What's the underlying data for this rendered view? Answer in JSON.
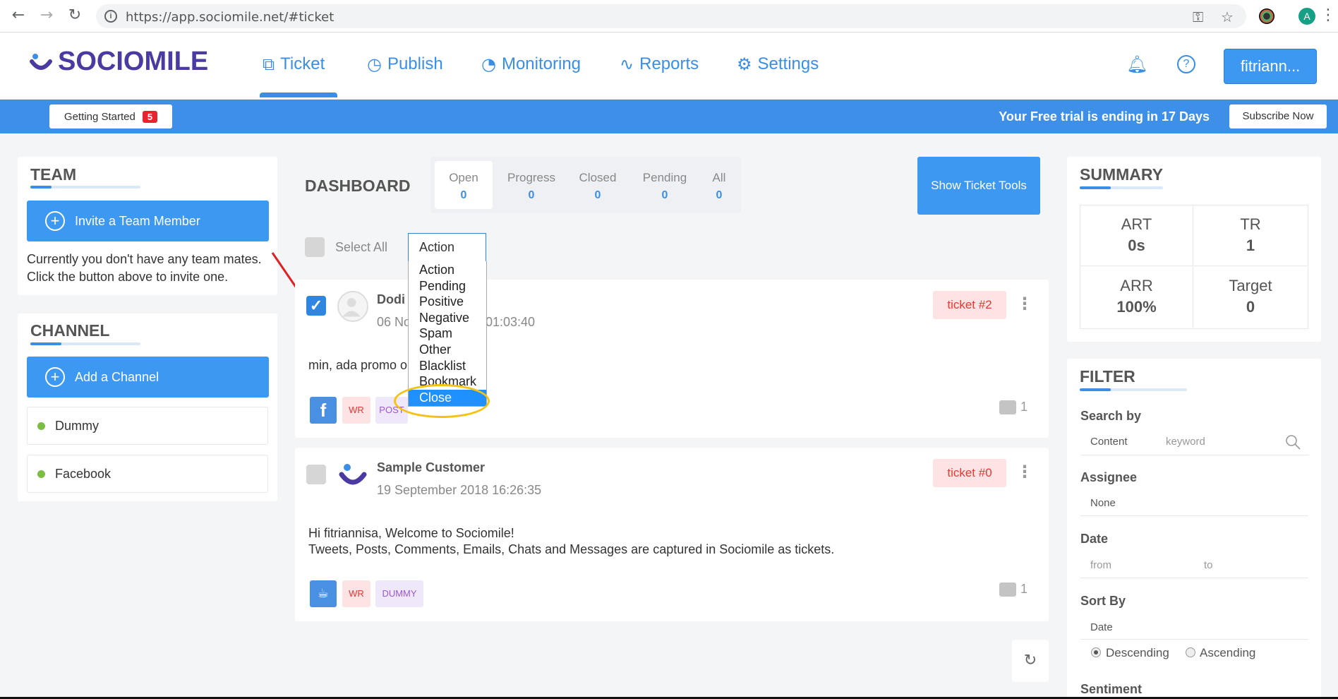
{
  "browser": {
    "url": "https://app.sociomile.net/#ticket",
    "back_icon": "arrow-left-icon",
    "forward_icon": "arrow-right-icon",
    "reload_icon": "reload-icon",
    "profile_initial": "A"
  },
  "header": {
    "logo_text": "SOCIOMILE",
    "nav": [
      {
        "label": "Ticket",
        "icon": "ticket-icon"
      },
      {
        "label": "Publish",
        "icon": "timer-icon"
      },
      {
        "label": "Monitoring",
        "icon": "gauge-icon"
      },
      {
        "label": "Reports",
        "icon": "pulse-icon"
      },
      {
        "label": "Settings",
        "icon": "gear-icon"
      }
    ],
    "user_label": "fitriann..."
  },
  "banner": {
    "getting_started_label": "Getting Started",
    "getting_started_count": "5",
    "trial_text": "Your Free trial is ending in 17 Days",
    "subscribe_label": "Subscribe Now"
  },
  "team": {
    "title": "TEAM",
    "invite_label": "Invite a Team Member",
    "empty_line1": "Currently you don't have any team mates.",
    "empty_line2": "Click the button above to invite one."
  },
  "channel": {
    "title": "CHANNEL",
    "add_label": "Add a Channel",
    "items": [
      "Dummy",
      "Facebook"
    ],
    "status_color": "#7cbd42"
  },
  "dashboard": {
    "title": "DASHBOARD",
    "tabs": [
      {
        "label": "Open",
        "count": "0"
      },
      {
        "label": "Progress",
        "count": "0"
      },
      {
        "label": "Closed",
        "count": "0"
      },
      {
        "label": "Pending",
        "count": "0"
      },
      {
        "label": "All",
        "count": "0"
      }
    ],
    "show_tools_label": "Show Ticket Tools",
    "select_all_label": "Select All",
    "action_selected": "Action",
    "action_options": [
      "Action",
      "Pending",
      "Positive",
      "Negative",
      "Spam",
      "Other",
      "Blacklist",
      "Bookmark",
      "Close"
    ],
    "highlighted_option": "Close"
  },
  "tickets": [
    {
      "name": "Dodi",
      "date_start": "06 No",
      "date_end": "01:03:40",
      "badge": "ticket #2",
      "body": "min, ada promo or",
      "tags": [
        "f",
        "WR",
        "POST"
      ],
      "comments": "1"
    },
    {
      "name": "Sample Customer",
      "date": "19 September 2018 16:26:35",
      "badge": "ticket #0",
      "body_line1": "Hi fitriannisa, Welcome to Sociomile!",
      "body_line2": "Tweets, Posts, Comments, Emails, Chats and Messages are captured in Sociomile as tickets.",
      "tags": [
        "WR",
        "DUMMY"
      ],
      "comments": "1"
    }
  ],
  "summary": {
    "title": "SUMMARY",
    "cells": [
      {
        "label": "ART",
        "value": "0s"
      },
      {
        "label": "TR",
        "value": "1"
      },
      {
        "label": "ARR",
        "value": "100%"
      },
      {
        "label": "Target",
        "value": "0"
      }
    ]
  },
  "filter": {
    "title": "FILTER",
    "search_by_label": "Search by",
    "search_field": "Content",
    "search_placeholder": "keyword",
    "assignee_label": "Assignee",
    "assignee_value": "None",
    "date_label": "Date",
    "date_from": "from",
    "date_to": "to",
    "sort_label": "Sort By",
    "sort_value": "Date",
    "desc_label": "Descending",
    "asc_label": "Ascending",
    "sentiment_label": "Sentiment"
  },
  "colors": {
    "brand_blue": "#3d98f2",
    "logo_purple": "#4a3ba3",
    "badge_red": "#e53935",
    "highlight_yellow": "#f5c211"
  }
}
